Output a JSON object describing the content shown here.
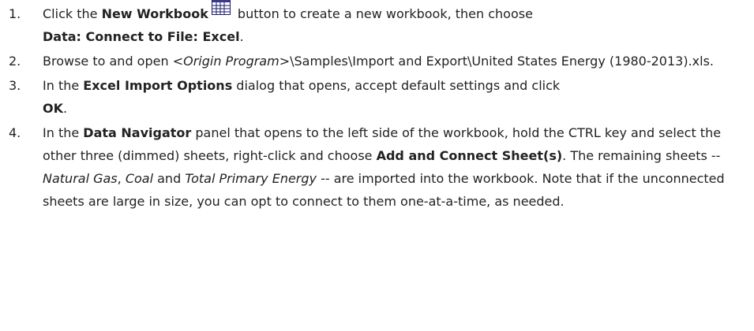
{
  "steps": [
    {
      "number": "1.",
      "parts": {
        "a": "Click the ",
        "b": "New Workbook",
        "c": " button to create a new workbook, then choose",
        "d": "Data: Connect to File: Excel",
        "e": "."
      },
      "icon": "workbook-grid-icon"
    },
    {
      "number": "2.",
      "parts": {
        "a": "Browse to and open <",
        "b": "Origin Program",
        "c": ">\\Samples\\Import and Export\\United States Energy (1980-2013).xls."
      }
    },
    {
      "number": "3.",
      "parts": {
        "a": "In the ",
        "b": "Excel Import Options",
        "c": " dialog that opens, accept default settings and click ",
        "d": "OK",
        "e": "."
      }
    },
    {
      "number": "4.",
      "parts": {
        "a": "In the ",
        "b": "Data Navigator",
        "c": " panel that opens to the left side of the workbook, hold the CTRL key and select the other three (dimmed) sheets, right-click and choose ",
        "d": "Add and Connect Sheet(s)",
        "e": ". The remaining sheets -- ",
        "f": "Natural Gas",
        "g": ", ",
        "h": "Coal",
        "i": " and ",
        "j": "Total Primary Energy",
        "k": " -- are imported into the workbook. Note that if the unconnected sheets are large in size, you can opt to connect to them one-at-a-time, as needed."
      }
    }
  ],
  "colors": {
    "text": "#222222",
    "icon_fill": "#ffffff",
    "icon_border": "#1a1a6e",
    "icon_header": "#3a3a8c"
  }
}
